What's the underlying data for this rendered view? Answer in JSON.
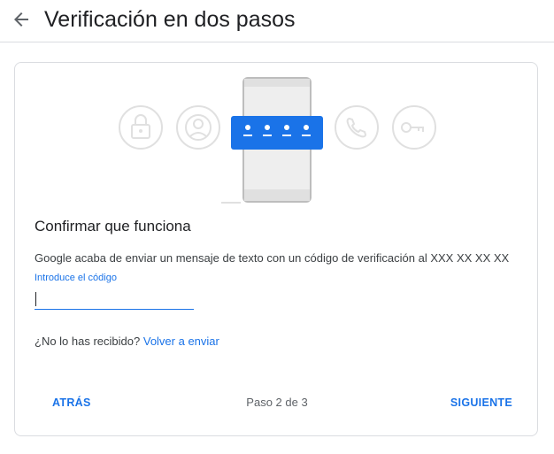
{
  "header": {
    "title": "Verificación en dos pasos",
    "back_icon": "arrow-back-icon"
  },
  "illustration": {
    "icons": [
      "lock-icon",
      "account-circle-icon",
      "phone-call-icon",
      "key-icon"
    ],
    "code_mask": "••••",
    "colors": {
      "circle_stroke": "#e0e0e0",
      "phone_body": "#eeeeee",
      "phone_edge": "#bdbdbd",
      "code_box": "#1a73e8"
    }
  },
  "main": {
    "title": "Confirmar que funciona",
    "message": "Google acaba de enviar un mensaje de texto con un código de verificación al XXX XX XX XX",
    "code_field": {
      "label": "Introduce el código",
      "value": ""
    },
    "resend": {
      "prompt": "¿No lo has recibido?",
      "link": "Volver a enviar"
    }
  },
  "footer": {
    "back_label": "ATRÁS",
    "step": "Paso 2 de 3",
    "next_label": "SIGUIENTE"
  },
  "colors": {
    "accent": "#1a73e8",
    "text": "#202124",
    "secondary_text": "#5f6368",
    "divider": "#dadce0"
  }
}
